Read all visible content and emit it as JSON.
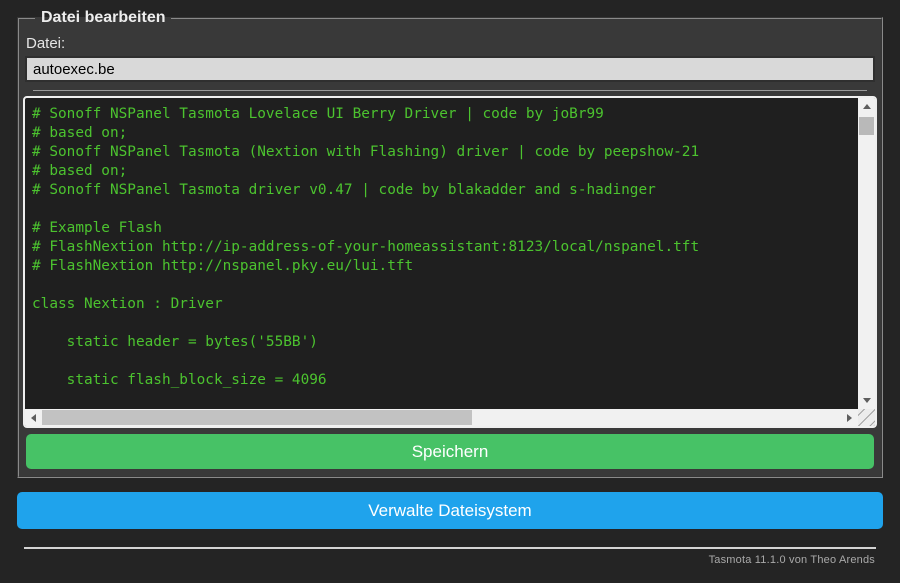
{
  "panel": {
    "legend": "Datei bearbeiten"
  },
  "file_form": {
    "label": "Datei:",
    "filename": "autoexec.be",
    "content": "# Sonoff NSPanel Tasmota Lovelace UI Berry Driver | code by joBr99\n# based on;\n# Sonoff NSPanel Tasmota (Nextion with Flashing) driver | code by peepshow-21\n# based on;\n# Sonoff NSPanel Tasmota driver v0.47 | code by blakadder and s-hadinger\n\n# Example Flash\n# FlashNextion http://ip-address-of-your-homeassistant:8123/local/nspanel.tft\n# FlashNextion http://nspanel.pky.eu/lui.tft\n\nclass Nextion : Driver\n\n    static header = bytes('55BB')\n\n    static flash_block_size = 4096\n",
    "save_label": "Speichern"
  },
  "filesystem": {
    "manage_label": "Verwalte Dateisystem"
  },
  "footer": {
    "version": "Tasmota 11.1.0 von Theo Arends"
  },
  "icons": {
    "scroll_up": "scroll-up-arrow",
    "scroll_down": "scroll-down-arrow",
    "scroll_left": "scroll-left-arrow",
    "scroll_right": "scroll-right-arrow",
    "resize_grip": "resize-grip"
  },
  "colors": {
    "page_bg": "#242424",
    "panel_bg": "#393939",
    "console_bg": "#1f1f1f",
    "console_text": "#4cc32f",
    "save_button": "#47c266",
    "manage_button": "#1fa3ec",
    "button_text": "#ffffff",
    "input_bg": "#d9d9d9"
  }
}
